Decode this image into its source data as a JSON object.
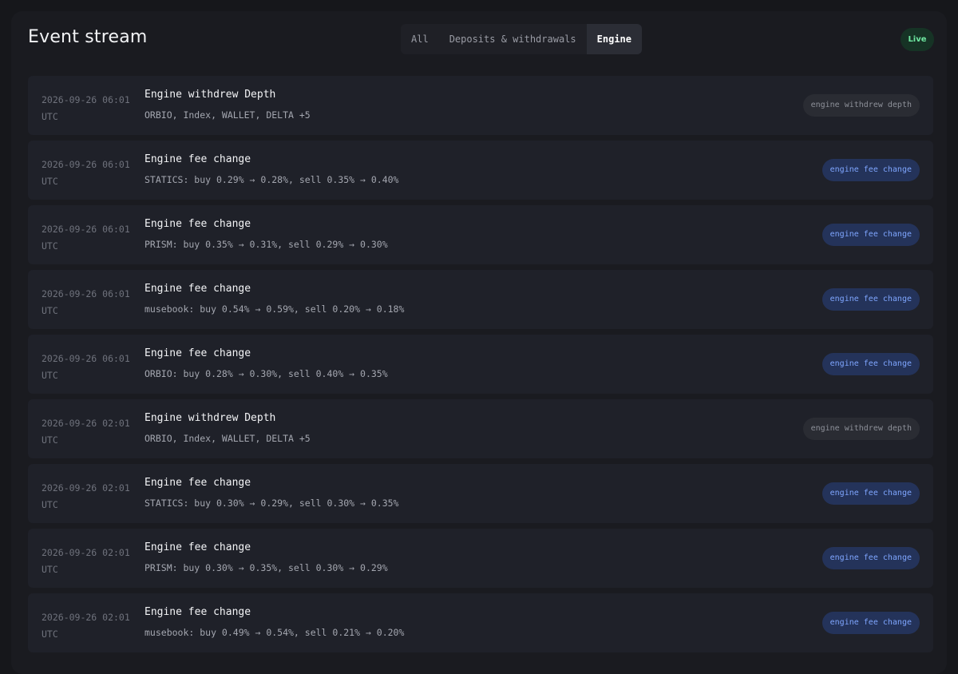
{
  "header": {
    "title": "Event stream",
    "live_label": "Live"
  },
  "tabs": [
    {
      "label": "All",
      "active": false
    },
    {
      "label": "Deposits & withdrawals",
      "active": false
    },
    {
      "label": "Engine",
      "active": true
    }
  ],
  "colors": {
    "live_green": "#6ee7a0",
    "fee_change_blue": "#7fa6ff",
    "withdrew_gray": "#8d9099"
  },
  "events": [
    {
      "date": "2026-09-26 06:01",
      "tz": "UTC",
      "title": "Engine withdrew Depth",
      "desc": "ORBIO, Index, WALLET, DELTA +5",
      "tag": "engine withdrew depth",
      "tag_style": "gray"
    },
    {
      "date": "2026-09-26 06:01",
      "tz": "UTC",
      "title": "Engine fee change",
      "desc": "STATICS: buy 0.29% → 0.28%, sell 0.35% → 0.40%",
      "tag": "engine fee change",
      "tag_style": "blue"
    },
    {
      "date": "2026-09-26 06:01",
      "tz": "UTC",
      "title": "Engine fee change",
      "desc": "PRISM: buy 0.35% → 0.31%, sell 0.29% → 0.30%",
      "tag": "engine fee change",
      "tag_style": "blue"
    },
    {
      "date": "2026-09-26 06:01",
      "tz": "UTC",
      "title": "Engine fee change",
      "desc": "musebook: buy 0.54% → 0.59%, sell 0.20% → 0.18%",
      "tag": "engine fee change",
      "tag_style": "blue"
    },
    {
      "date": "2026-09-26 06:01",
      "tz": "UTC",
      "title": "Engine fee change",
      "desc": "ORBIO: buy 0.28% → 0.30%, sell 0.40% → 0.35%",
      "tag": "engine fee change",
      "tag_style": "blue"
    },
    {
      "date": "2026-09-26 02:01",
      "tz": "UTC",
      "title": "Engine withdrew Depth",
      "desc": "ORBIO, Index, WALLET, DELTA +5",
      "tag": "engine withdrew depth",
      "tag_style": "gray"
    },
    {
      "date": "2026-09-26 02:01",
      "tz": "UTC",
      "title": "Engine fee change",
      "desc": "STATICS: buy 0.30% → 0.29%, sell 0.30% → 0.35%",
      "tag": "engine fee change",
      "tag_style": "blue"
    },
    {
      "date": "2026-09-26 02:01",
      "tz": "UTC",
      "title": "Engine fee change",
      "desc": "PRISM: buy 0.30% → 0.35%, sell 0.30% → 0.29%",
      "tag": "engine fee change",
      "tag_style": "blue"
    },
    {
      "date": "2026-09-26 02:01",
      "tz": "UTC",
      "title": "Engine fee change",
      "desc": "musebook: buy 0.49% → 0.54%, sell 0.21% → 0.20%",
      "tag": "engine fee change",
      "tag_style": "blue"
    }
  ]
}
